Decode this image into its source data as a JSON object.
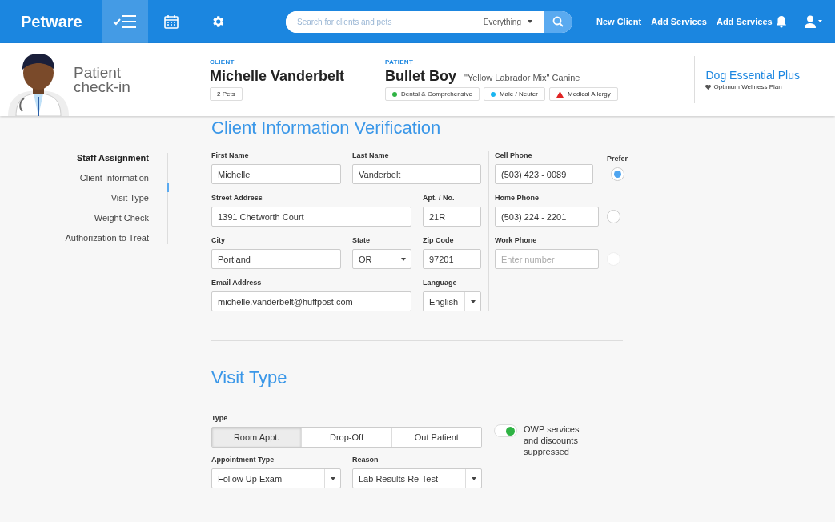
{
  "topbar": {
    "brand": "Petware",
    "icons": [
      {
        "kind": "checklist",
        "selected": true
      },
      {
        "kind": "calendar",
        "selected": false
      },
      {
        "kind": "settings",
        "selected": false
      }
    ],
    "search": {
      "placeholder": "Search for clients and pets",
      "scope": "Everything"
    },
    "links": [
      "New Client",
      "Add Services",
      "Add Services"
    ]
  },
  "header": {
    "title_lines": [
      "Patient",
      "check-in"
    ],
    "client": {
      "label": "CLIENT",
      "name": "Michelle Vanderbelt",
      "tags": [
        "2 Pets"
      ]
    },
    "patient": {
      "label": "PATIENT",
      "name": "Bullet Boy",
      "breed": "\"Yellow Labrador Mix\" Canine",
      "tags": [
        {
          "kind": "dot",
          "color": "#2fb344",
          "text": "Dental & Comprehensive"
        },
        {
          "kind": "dot",
          "color": "#19b5f0",
          "text": "Male / Neuter"
        },
        {
          "kind": "warning",
          "color": "#e02424",
          "text": "Medical Allergy"
        }
      ]
    },
    "plan": {
      "name": "Dog Essential Plus",
      "subtitle": "Optimum Wellness Plan"
    }
  },
  "steps": [
    {
      "label": "Staff Assignment",
      "selected": true
    },
    {
      "label": "Client Information",
      "selected": false
    },
    {
      "label": "Visit Type",
      "selected": false
    },
    {
      "label": "Weight Check",
      "selected": false
    },
    {
      "label": "Authorization to Treat",
      "selected": false
    }
  ],
  "client_info": {
    "title": "Client Information Verification",
    "fields": [
      {
        "label": "First Name",
        "value": "Michelle",
        "kind": "text"
      },
      {
        "label": "Last Name",
        "value": "Vanderbelt",
        "kind": "text"
      },
      {
        "label": "Street Address",
        "value": "1391 Chetworth Court",
        "kind": "text"
      },
      {
        "label": "Apt. / No.",
        "value": "21R",
        "kind": "text"
      },
      {
        "label": "City",
        "value": "Portland",
        "kind": "text"
      },
      {
        "label": "State",
        "value": "OR",
        "kind": "select"
      },
      {
        "label": "Zip Code",
        "value": "97201",
        "kind": "text"
      },
      {
        "label": "Email Address",
        "value": "michelle.vanderbelt@huffpost.com",
        "kind": "text"
      },
      {
        "label": "Language",
        "value": "English",
        "kind": "select"
      }
    ],
    "prefer_label": "Prefer",
    "phones": [
      {
        "label": "Cell Phone",
        "value": "(503) 423 - 0089",
        "selected": true,
        "disabled": false
      },
      {
        "label": "Home Phone",
        "value": "(503) 224 - 2201",
        "selected": false,
        "disabled": false
      },
      {
        "label": "Work Phone",
        "placeholder": "Enter number",
        "selected": false,
        "disabled": true
      }
    ]
  },
  "visit_type": {
    "title": "Visit Type",
    "type_label": "Type",
    "types": [
      {
        "label": "Room Appt.",
        "selected": true
      },
      {
        "label": "Drop-Off",
        "selected": false
      },
      {
        "label": "Out Patient",
        "selected": false
      }
    ],
    "owp": {
      "on": true,
      "text": "OWP services and discounts suppressed"
    },
    "selects": [
      {
        "label": "Appointment Type",
        "value": "Follow Up Exam"
      },
      {
        "label": "Reason",
        "value": "Lab Results Re-Test"
      }
    ]
  }
}
